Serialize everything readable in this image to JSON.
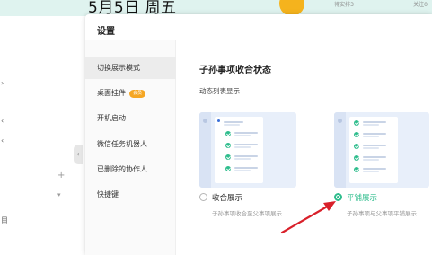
{
  "background": {
    "header_date": "5月5日 周五",
    "header_pills": [
      "待安排3",
      "关注0"
    ],
    "sidebar_marks": [
      "+",
      "+",
      "▾",
      "目"
    ]
  },
  "modal": {
    "title": "设置",
    "sidebar": {
      "items": [
        {
          "label": "切换展示模式",
          "active": true
        },
        {
          "label": "桌面挂件",
          "badge": "会员"
        },
        {
          "label": "开机启动"
        },
        {
          "label": "微信任务机器人"
        },
        {
          "label": "已删除的协作人"
        },
        {
          "label": "快捷键"
        }
      ]
    },
    "content": {
      "heading": "子孙事项收合状态",
      "sublabel": "动态列表显示",
      "options": [
        {
          "label": "收合展示",
          "desc": "子孙事项收合至父事项展示",
          "selected": false
        },
        {
          "label": "平铺展示",
          "desc": "子孙事项与父事项平铺展示",
          "selected": true
        }
      ]
    }
  },
  "colors": {
    "accent": "#2fbd8d",
    "annotation_arrow": "#d9202a",
    "topbar": "#dff3ef"
  }
}
